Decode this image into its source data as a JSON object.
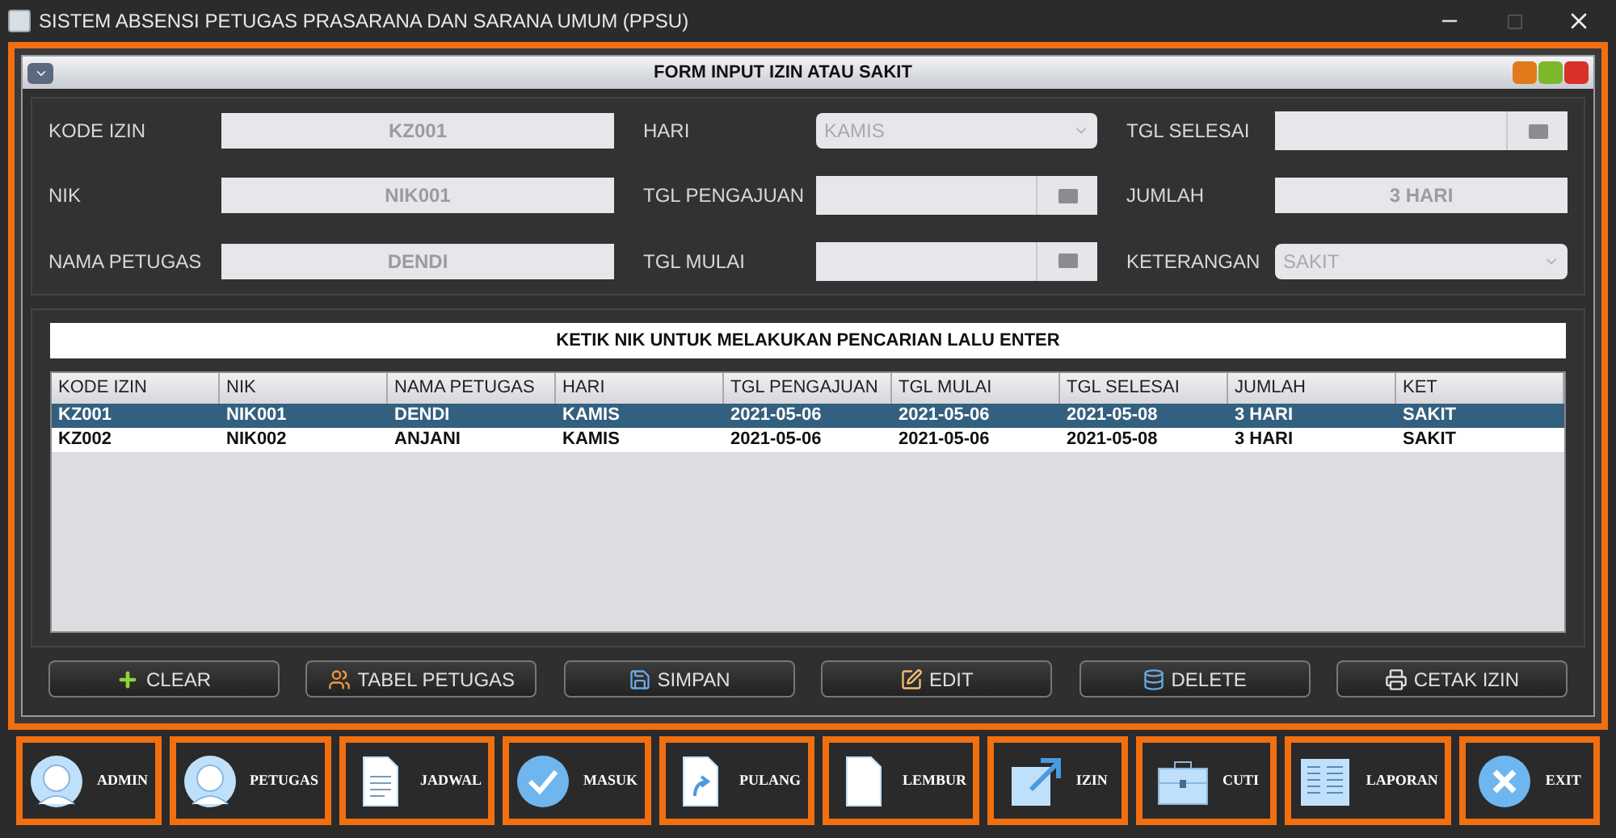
{
  "window": {
    "title": "SISTEM ABSENSI PETUGAS PRASARANA DAN SARANA UMUM (PPSU)"
  },
  "form_window": {
    "title": "FORM INPUT IZIN ATAU SAKIT"
  },
  "fields": [
    {
      "kind": "text",
      "label": "KODE IZIN",
      "value": "KZ001"
    },
    {
      "kind": "combo",
      "label": "HARI",
      "value": "KAMIS"
    },
    {
      "kind": "date",
      "label": "TGL SELESAI"
    },
    {
      "kind": "text",
      "label": "NIK",
      "value": "NIK001"
    },
    {
      "kind": "date",
      "label": "TGL PENGAJUAN"
    },
    {
      "kind": "text",
      "label": "JUMLAH",
      "value": "3 HARI"
    },
    {
      "kind": "text",
      "label": "NAMA PETUGAS",
      "value": "DENDI"
    },
    {
      "kind": "date",
      "label": "TGL MULAI"
    },
    {
      "kind": "combo",
      "label": "KETERANGAN",
      "value": "SAKIT"
    }
  ],
  "search": {
    "placeholder": "KETIK NIK UNTUK MELAKUKAN PENCARIAN LALU ENTER"
  },
  "table": {
    "columns": [
      "KODE IZIN",
      "NIK",
      "NAMA PETUGAS",
      "HARI",
      "TGL PENGAJUAN",
      "TGL MULAI",
      "TGL SELESAI",
      "JUMLAH",
      "KET"
    ],
    "rows": [
      {
        "selected": true,
        "cells": [
          "KZ001",
          "NIK001",
          "DENDI",
          "KAMIS",
          "2021-05-06",
          "2021-05-06",
          "2021-05-08",
          "3 HARI",
          "SAKIT"
        ]
      },
      {
        "selected": false,
        "cells": [
          "KZ002",
          "NIK002",
          "ANJANI",
          "KAMIS",
          "2021-05-06",
          "2021-05-06",
          "2021-05-08",
          "3 HARI",
          "SAKIT"
        ]
      }
    ]
  },
  "buttons": [
    "CLEAR",
    "TABEL PETUGAS",
    "SIMPAN",
    "EDIT",
    "DELETE",
    "CETAK IZIN"
  ],
  "nav": [
    "ADMIN",
    "PETUGAS",
    "JADWAL",
    "MASUK",
    "PULANG",
    "LEMBUR",
    "IZIN",
    "CUTI",
    "LAPORAN",
    "EXIT"
  ]
}
